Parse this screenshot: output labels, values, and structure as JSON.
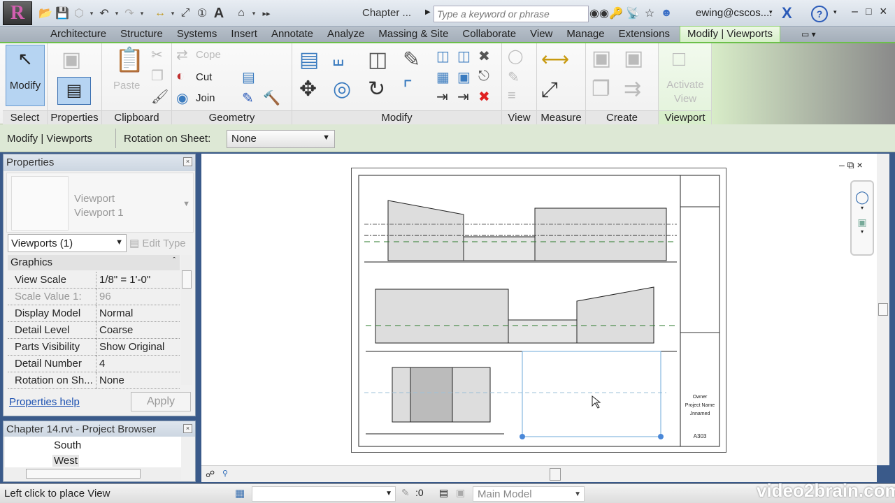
{
  "titlebar": {
    "app_icon": "R",
    "document_title": "Chapter ...",
    "search_placeholder": "Type a keyword or phrase",
    "user": "ewing@cscos...."
  },
  "tabs": [
    "Architecture",
    "Structure",
    "Systems",
    "Insert",
    "Annotate",
    "Analyze",
    "Massing & Site",
    "Collaborate",
    "View",
    "Manage",
    "Extensions",
    "Modify | Viewports"
  ],
  "ribbon": {
    "panels": {
      "select": "Select",
      "properties": "Properties",
      "clipboard": "Clipboard",
      "geometry": "Geometry",
      "modify": "Modify",
      "view": "View",
      "measure": "Measure",
      "create": "Create",
      "viewport": "Viewport"
    },
    "modify_label": "Modify",
    "paste_label": "Paste",
    "cope_label": "Cope",
    "cut_label": "Cut",
    "join_label": "Join",
    "activate_view_label": "Activate View"
  },
  "options_bar": {
    "context": "Modify | Viewports",
    "rotation_label": "Rotation on Sheet:",
    "rotation_value": "None"
  },
  "properties": {
    "title": "Properties",
    "type_family": "Viewport",
    "type_name": "Viewport 1",
    "selector": "Viewports (1)",
    "edit_type": "Edit Type",
    "group": "Graphics",
    "rows": [
      {
        "k": "View Scale",
        "v": "1/8\" = 1'-0\""
      },
      {
        "k": "Scale Value    1:",
        "v": "96"
      },
      {
        "k": "Display Model",
        "v": "Normal"
      },
      {
        "k": "Detail Level",
        "v": "Coarse"
      },
      {
        "k": "Parts Visibility",
        "v": "Show Original"
      },
      {
        "k": "Detail Number",
        "v": "4"
      },
      {
        "k": "Rotation on Sh...",
        "v": "None"
      }
    ],
    "help_link": "Properties help",
    "apply": "Apply"
  },
  "project_browser": {
    "title": "Chapter 14.rvt - Project Browser",
    "items": [
      "South",
      "West"
    ]
  },
  "sheet": {
    "title_block": {
      "owner": "Owner",
      "project": "Project Name",
      "unnamed": "Jnnamed",
      "number": "A303"
    }
  },
  "status": {
    "hint": "Left click to place View",
    "count": ":0",
    "model": "Main Model"
  },
  "watermark": "video2brain.com"
}
